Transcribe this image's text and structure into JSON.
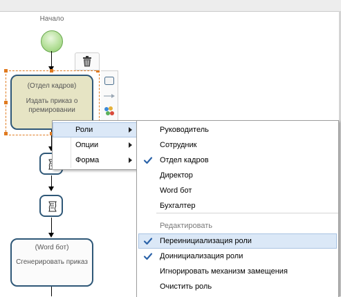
{
  "diagram": {
    "start_label": "Начало",
    "task_hr": {
      "role": "(Отдел кадров)",
      "name": "Издать приказ о премировании"
    },
    "task_word": {
      "role": "(Word бот)",
      "name": "Сгенерировать приказ"
    }
  },
  "context_menu": {
    "items": [
      {
        "label": "Роли",
        "has_submenu": true
      },
      {
        "label": "Опции",
        "has_submenu": true
      },
      {
        "label": "Форма",
        "has_submenu": true
      }
    ]
  },
  "roles_submenu": {
    "roles": [
      {
        "label": "Руководитель",
        "checked": false
      },
      {
        "label": "Сотрудник",
        "checked": false
      },
      {
        "label": "Отдел кадров",
        "checked": true
      },
      {
        "label": "Директор",
        "checked": false
      },
      {
        "label": "Word бот",
        "checked": false
      },
      {
        "label": "Бухгалтер",
        "checked": false
      }
    ],
    "section_label": "Редактировать",
    "actions": [
      {
        "label": "Переинициализация роли",
        "checked": true
      },
      {
        "label": "Доинициализация роли",
        "checked": true
      },
      {
        "label": "Игнорировать механизм замещения",
        "checked": false
      },
      {
        "label": "Очистить роль",
        "checked": false
      }
    ]
  },
  "colors": {
    "selection": "#e07a1f",
    "task_border": "#2e5777",
    "task_hr_fill": "#e6e4c4",
    "menu_highlight": "#dbe8f7",
    "checkmark": "#2a62a8"
  }
}
